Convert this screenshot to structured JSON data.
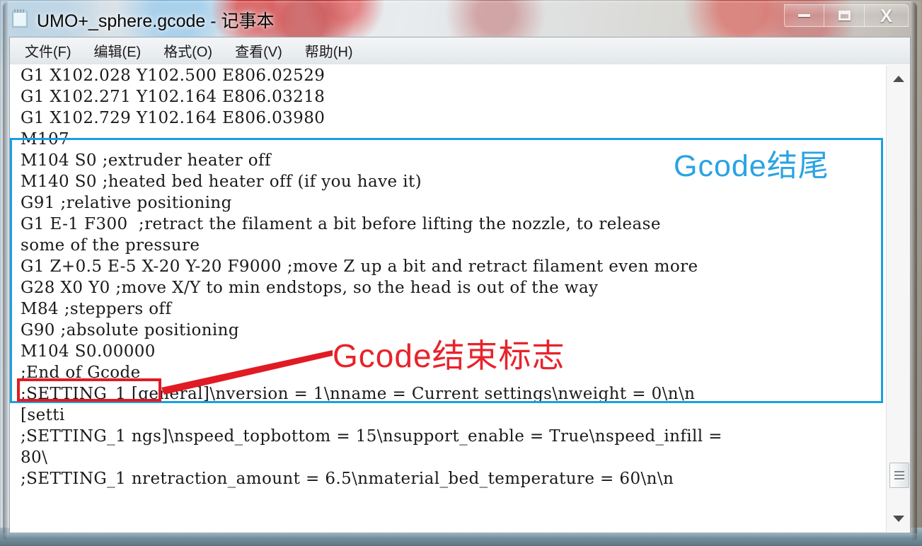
{
  "window": {
    "title": "UMO+_sphere.gcode - 记事本",
    "icon": "notepad-icon",
    "controls": {
      "minimize": "—",
      "maximize": "❑",
      "close": "X"
    }
  },
  "menu": {
    "items": [
      {
        "label": "文件(F)",
        "name": "menu-file"
      },
      {
        "label": "编辑(E)",
        "name": "menu-edit"
      },
      {
        "label": "格式(O)",
        "name": "menu-format"
      },
      {
        "label": "查看(V)",
        "name": "menu-view"
      },
      {
        "label": "帮助(H)",
        "name": "menu-help"
      }
    ]
  },
  "editor": {
    "lines": [
      "G1 X102.028 Y102.500 E806.02529",
      "G1 X102.271 Y102.164 E806.03218",
      "G1 X102.729 Y102.164 E806.03980",
      "M107",
      "M104 S0 ;extruder heater off",
      "M140 S0 ;heated bed heater off (if you have it)",
      "G91 ;relative positioning",
      "G1 E-1 F300  ;retract the filament a bit before lifting the nozzle, to release",
      "some of the pressure",
      "G1 Z+0.5 E-5 X-20 Y-20 F9000 ;move Z up a bit and retract filament even more",
      "G28 X0 Y0 ;move X/Y to min endstops, so the head is out of the way",
      "M84 ;steppers off",
      "G90 ;absolute positioning",
      "M104 S0.00000",
      ";End of Gcode",
      ";SETTING_1 [general]\\nversion = 1\\nname = Current settings\\nweight = 0\\n\\n",
      "[setti",
      ";SETTING_1 ngs]\\nspeed_topbottom = 15\\nsupport_enable = True\\nspeed_infill =",
      "80\\",
      ";SETTING_1 nretraction_amount = 6.5\\nmaterial_bed_temperature = 60\\n\\n"
    ]
  },
  "annotations": {
    "blue": {
      "label": "Gcode结尾",
      "color": "#29a3e3"
    },
    "red": {
      "label": "Gcode结束标志",
      "color": "#e8232b",
      "highlighted_text": ";End of Gcode"
    }
  },
  "scrollbar": {
    "up_arrow": "▲",
    "down_arrow": "▼"
  }
}
